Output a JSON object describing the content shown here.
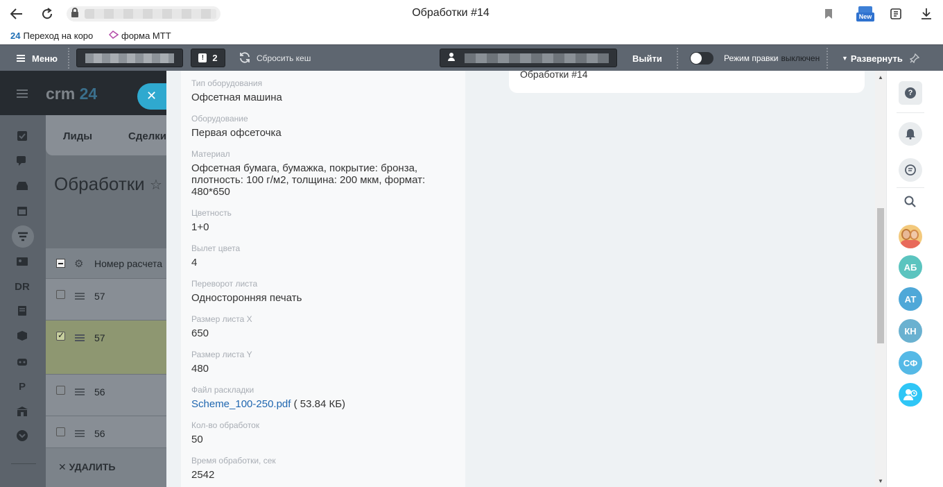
{
  "browser": {
    "title": "Обработки #14",
    "bookmarks": [
      {
        "icon": "24",
        "label": "Переход на короб"
      },
      {
        "icon": "form-icon",
        "label": "форма МТТ"
      }
    ],
    "new_badge": "New"
  },
  "adminbar": {
    "menu_label": "Меню",
    "counter": "2",
    "reset_cache": "Сбросить кеш",
    "logout": "Выйти",
    "edit_mode_label": "Режим правки",
    "edit_mode_state": "выключен",
    "expand": "Развернуть"
  },
  "crm": {
    "logo_text": "crm",
    "logo_num": "24",
    "tabs": [
      "Лиды",
      "Сделки"
    ],
    "page_title": "Обработки",
    "column_header": "Номер расчета",
    "rows": [
      {
        "num": "57",
        "checked": false
      },
      {
        "num": "57",
        "checked": true
      },
      {
        "num": "56",
        "checked": false
      },
      {
        "num": "56",
        "checked": false
      }
    ],
    "delete_label": "УДАЛИТЬ",
    "left_icons": [
      "tasks-icon",
      "chat-icon",
      "inbox-icon",
      "calendar-icon",
      "filter-icon",
      "contacts-icon",
      "DR",
      "document-icon",
      "box-icon",
      "robot-icon",
      "P",
      "bank-icon",
      "more-icon"
    ]
  },
  "slider": {
    "right_card_title": "Обработки #14",
    "fields": [
      {
        "label": "Тип оборудования",
        "value": "Офсетная машина"
      },
      {
        "label": "Оборудование",
        "value": "Первая офсеточка"
      },
      {
        "label": "Материал",
        "value": "Офсетная бумага, бумажка, покрытие: бронза, плотность: 100 г/м2, толщина: 200 мкм, формат: 480*650"
      },
      {
        "label": "Цветность",
        "value": "1+0"
      },
      {
        "label": "Вылет цвета",
        "value": "4"
      },
      {
        "label": "Переворот листа",
        "value": "Односторонняя печать"
      },
      {
        "label": "Размер листа X",
        "value": "650"
      },
      {
        "label": "Размер листа Y",
        "value": "480"
      },
      {
        "label": "Файл раскладки",
        "value": "Scheme_100-250.pdf",
        "extra": "( 53.84 КБ)"
      },
      {
        "label": "Кол-во обработок",
        "value": "50"
      },
      {
        "label": "Время обработки, сек",
        "value": "2542"
      }
    ]
  },
  "right_sidebar": {
    "avatars": [
      {
        "initials": "АБ",
        "color": "#5bc4bf"
      },
      {
        "initials": "АТ",
        "color": "#4fa8d8"
      },
      {
        "initials": "КН",
        "color": "#6ab1d0"
      },
      {
        "initials": "СФ",
        "color": "#55b9e6"
      }
    ]
  }
}
